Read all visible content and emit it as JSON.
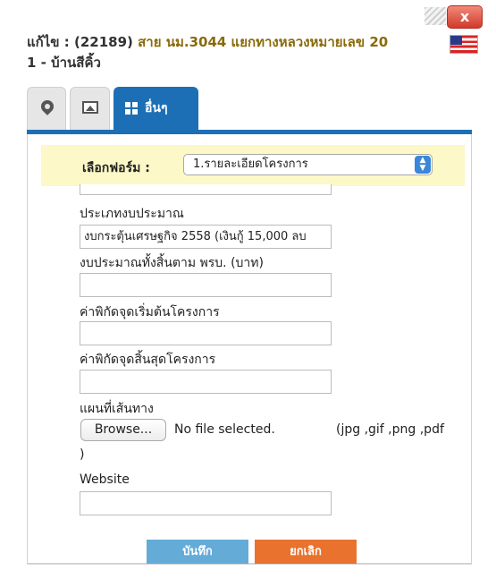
{
  "window": {
    "title_prefix": "แก้ไข : ",
    "title_code": "(22189)",
    "title_road": "สาย นม.3044 แยกทางหลวงหมายเลข 20",
    "title_line2": "1 - บ้านสีคิ้ว",
    "close_label": "x"
  },
  "tabs": {
    "other_label": "อื่นๆ"
  },
  "form": {
    "select_label": "เลือกฟอร์ม :",
    "select_value": "1.รายละเอียดโครงการ",
    "fields": [
      {
        "label": "ประเภทงบประมาณ",
        "value": "งบกระตุ้นเศรษฐกิจ 2558 (เงินกู้ 15,000 ลบ"
      },
      {
        "label": "งบประมาณทั้งสิ้นตาม พรบ. (บาท)",
        "value": ""
      },
      {
        "label": "ค่าพิกัดจุดเริ่มต้นโครงการ",
        "value": ""
      },
      {
        "label": "ค่าพิกัดจุดสิ้นสุดโครงการ",
        "value": ""
      }
    ],
    "map_label": "แผนที่เส้นทาง",
    "browse_label": "Browse...",
    "no_file_label": "No file selected.",
    "file_hint": "(jpg ,gif ,png ,pdf",
    "file_hint_end": ")",
    "website_label": "Website",
    "website_value": ""
  },
  "buttons": {
    "save_label": "บันทึก",
    "cancel_label": "ยกเลิก"
  },
  "colors": {
    "tab_active": "#1d6fb5",
    "save": "#64abd8",
    "cancel": "#e9722f",
    "form_bar": "#fcf8c8"
  }
}
